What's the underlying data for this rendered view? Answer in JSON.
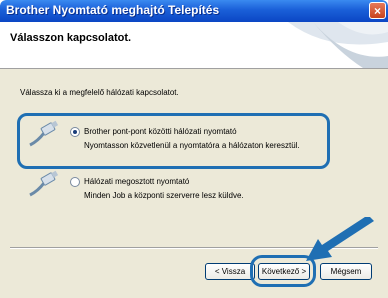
{
  "window": {
    "title": "Brother Nyomtató meghajtó Telepítés",
    "close_label": "×"
  },
  "header": {
    "title": "Válasszon kapcsolatot."
  },
  "instruction": "Válassza ki a megfelelő hálózati kapcsolatot.",
  "options": [
    {
      "label": "Brother pont-pont közötti hálózati nyomtató",
      "description": "Nyomtasson közvetlenül a nyomtatóra a hálózaton keresztül.",
      "selected": true
    },
    {
      "label": "Hálózati megosztott nyomtató",
      "description": "Minden Job a központi szerverre lesz küldve.",
      "selected": false
    }
  ],
  "buttons": {
    "back": "< Vissza",
    "next": "Következő >",
    "cancel": "Mégsem"
  },
  "colors": {
    "highlight": "#1f6fb3",
    "titlebar": "#0b46c4"
  }
}
